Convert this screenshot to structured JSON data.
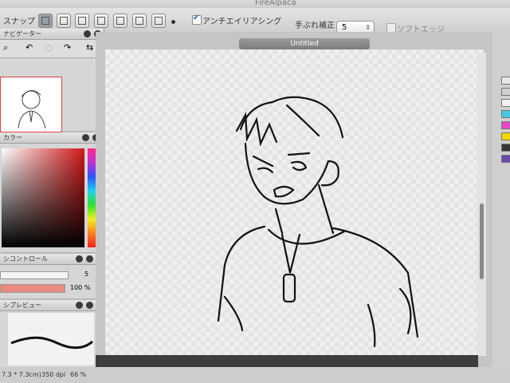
{
  "window": {
    "title": "FireAlpaca"
  },
  "toolbar": {
    "snap_label": "スナップ",
    "antialias_label": "アンチエイリアシング",
    "antialias_checked": true,
    "stabilizer_label": "手ぶれ補正",
    "stabilizer_value": "5",
    "softedge_label": "ソフトエッジ",
    "softedge_checked": false
  },
  "navigator": {
    "title": "ナビゲーター"
  },
  "color": {
    "title": "カラー",
    "accent": "#c82020"
  },
  "brush_control": {
    "title": "シコントロール",
    "size_value": "5",
    "opacity_value": "100 %"
  },
  "brush_preview": {
    "title": "シプレビュー"
  },
  "document": {
    "tab_title": "Untitled"
  },
  "status": {
    "size": "7.3 * 7.3cm)",
    "dpi": "350 dpi",
    "zoom": "66 %"
  },
  "palette_colors": [
    "#e7e7e7",
    "#cfcfcf",
    "#f2f2f2",
    "#48c8e8",
    "#e848c8",
    "#f0d800",
    "#383838",
    "#6a4aa8"
  ]
}
